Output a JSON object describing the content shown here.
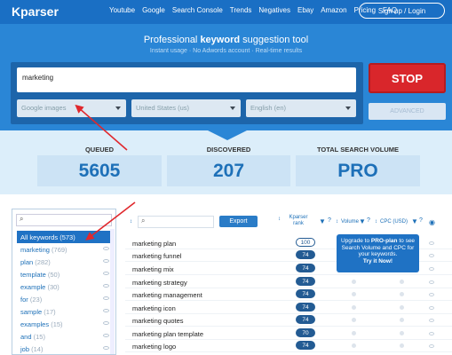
{
  "nav": {
    "brand": "Kparser",
    "links": [
      "Youtube",
      "Google",
      "Search Console",
      "Trends",
      "Negatives",
      "Ebay",
      "Amazon",
      "Pricing",
      "FAQ"
    ],
    "signup_label": "Sign up / Login"
  },
  "hero": {
    "title_pre": "Professional ",
    "title_bold": "keyword",
    "title_post": " suggestion tool",
    "subtitle": "Instant usage   ·   No Adwords account   ·   Real-time results"
  },
  "search": {
    "keyword_value": "marketing",
    "source_select": "Google images",
    "country_select": "United States (us)",
    "language_select": "English (en)",
    "stop_label": "STOP",
    "advanced_label": "ADVANCED"
  },
  "stats": {
    "queued_label": "QUEUED",
    "queued_value": "5605",
    "discovered_label": "DISCOVERED",
    "discovered_value": "207",
    "volume_label": "TOTAL SEARCH VOLUME",
    "volume_value": "PRO"
  },
  "sidebar": {
    "search_placeholder": "",
    "items": [
      {
        "label": "All keywords",
        "count": "(573)"
      },
      {
        "label": "marketing",
        "count": "(769)"
      },
      {
        "label": "plan",
        "count": "(282)"
      },
      {
        "label": "template",
        "count": "(50)"
      },
      {
        "label": "example",
        "count": "(30)"
      },
      {
        "label": "for",
        "count": "(23)"
      },
      {
        "label": "sample",
        "count": "(17)"
      },
      {
        "label": "examples",
        "count": "(15)"
      },
      {
        "label": "and",
        "count": "(15)"
      },
      {
        "label": "job",
        "count": "(14)"
      }
    ]
  },
  "table": {
    "export_label": "Export",
    "col_rank": "Kparser rank",
    "col_volume": "Volume",
    "col_cpc": "CPC (USD)",
    "rows": [
      {
        "keyword": "marketing plan",
        "rank": "100"
      },
      {
        "keyword": "marketing funnel",
        "rank": "74"
      },
      {
        "keyword": "marketing mix",
        "rank": "74"
      },
      {
        "keyword": "marketing strategy",
        "rank": "74"
      },
      {
        "keyword": "marketing management",
        "rank": "74"
      },
      {
        "keyword": "marketing icon",
        "rank": "74"
      },
      {
        "keyword": "marketing quotes",
        "rank": "74"
      },
      {
        "keyword": "marketing plan template",
        "rank": "70"
      },
      {
        "keyword": "marketing logo",
        "rank": "74"
      }
    ],
    "upgrade_line1_pre": "Upgrade to ",
    "upgrade_line1_bold": "PRO-plan",
    "upgrade_line1_post": " to see",
    "upgrade_line2": "Search Volume and CPC for",
    "upgrade_line3": "your keywords.",
    "upgrade_cta": "Try it Now!"
  },
  "colors": {
    "nav_bg": "#1a6fc4",
    "hero_bg": "#2a86d6",
    "stop_red": "#d9262b",
    "stat_blue": "#1d70b8",
    "annotation_arrow": "#e0282d"
  }
}
